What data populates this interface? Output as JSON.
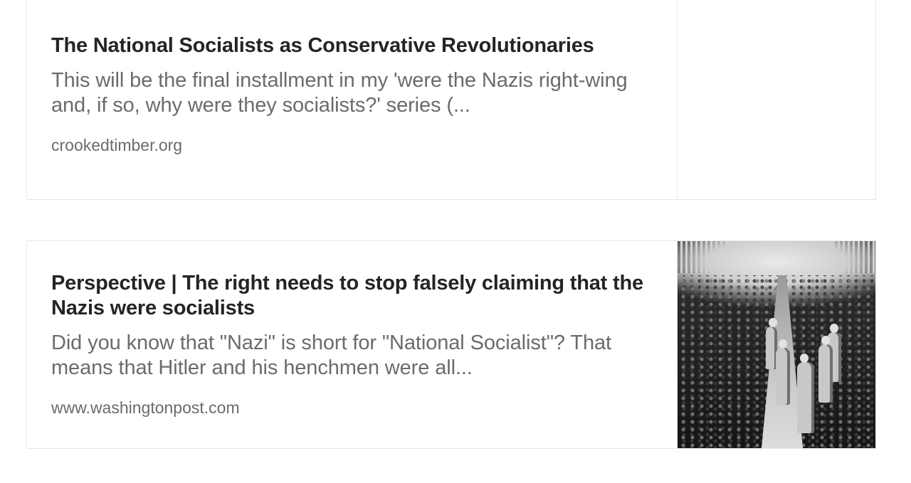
{
  "articles": [
    {
      "title": "The National Socialists as Conservative Revolutionaries",
      "description": "This will be the final installment in my 'were the Nazis right-wing and, if so, why were they socialists?' series (...",
      "source": "crookedtimber.org"
    },
    {
      "title": "Perspective | The right needs to stop falsely claiming that the Nazis were socialists",
      "description": "Did you know that \"Nazi\" is short for \"National Socialist\"? That means that Hitler and his henchmen were all...",
      "source": "www.washingtonpost.com"
    }
  ]
}
